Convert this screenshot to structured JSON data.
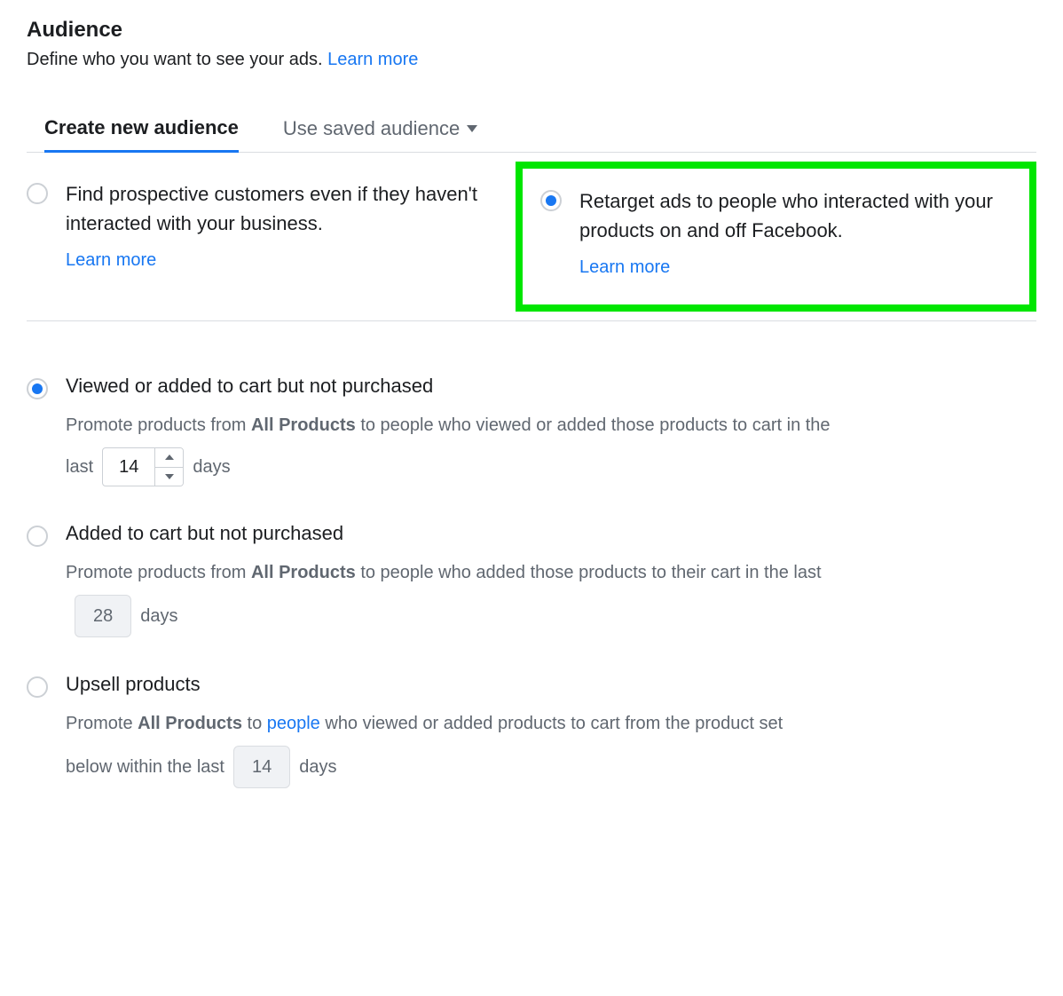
{
  "header": {
    "title": "Audience",
    "subtitle": "Define who you want to see your ads.",
    "learn_more": "Learn more"
  },
  "tabs": {
    "create_new": "Create new audience",
    "use_saved": "Use saved audience"
  },
  "audience_options": {
    "prospective": {
      "desc": "Find prospective customers even if they haven't interacted with your business.",
      "learn_more": "Learn more"
    },
    "retarget": {
      "desc": "Retarget ads to people who interacted with your products on and off Facebook.",
      "learn_more": "Learn more"
    }
  },
  "retarget_options": {
    "viewed_or_added": {
      "title": "Viewed or added to cart but not purchased",
      "desc_before": "Promote products from ",
      "desc_bold": "All Products",
      "desc_after": " to people who viewed or added those products to cart in the",
      "last_label": "last",
      "days_value": "14",
      "days_label": "days"
    },
    "added_not_purchased": {
      "title": "Added to cart but not purchased",
      "desc_before": "Promote products from ",
      "desc_bold": "All Products",
      "desc_after": " to people who added those products to their cart in the last",
      "days_value": "28",
      "days_label": "days"
    },
    "upsell": {
      "title": "Upsell products",
      "desc_before": "Promote ",
      "desc_bold": "All Products",
      "desc_mid": " to ",
      "people_link": "people",
      "desc_after": " who viewed or added products to cart from the product set",
      "below_label": "below within the last",
      "days_value": "14",
      "days_label": "days"
    }
  }
}
